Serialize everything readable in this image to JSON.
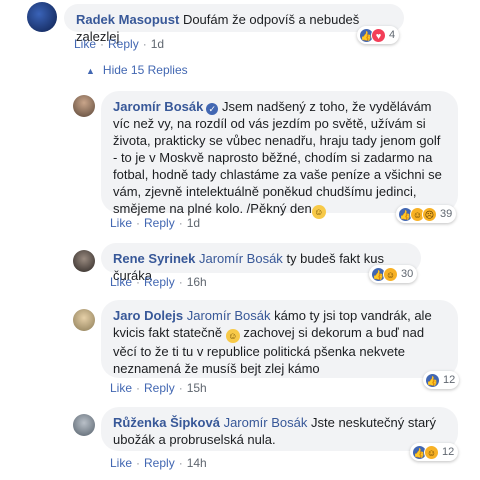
{
  "colors": {
    "link": "#385898",
    "bubble": "#f2f3f5",
    "action": "#4267b2"
  },
  "hide_replies": "Hide 15 Replies",
  "comments": [
    {
      "author": "Radek Masopust",
      "text": "Doufám že odpovíš a nebudeš zalezlej",
      "like": "Like",
      "reply": "Reply",
      "time": "1d",
      "reactions": "4",
      "reaction_icons": [
        "like-icon",
        "love-icon"
      ]
    },
    {
      "author": "Jaromír Bosák",
      "text": "Jsem nadšený z toho, že vydělávám víc než vy, na rozdíl od vás jezdím po světě, užívám si života, prakticky se vůbec nenadřu, hraju tady jenom golf - to je v Moskvě naprosto běžné, chodím si zadarmo na fotbal, hodně tady chlastáme za vaše peníze a všichni se vám, zjevně intelektuálně poněkud chudšímu jedinci, smějeme na plné kolo. /Pěkný den",
      "like": "Like",
      "reply": "Reply",
      "time": "1d",
      "reactions": "39",
      "reaction_icons": [
        "like-icon",
        "haha-icon",
        "sad-icon"
      ]
    },
    {
      "author": "Rene Syrinek",
      "mention": "Jaromír Bosák",
      "text": "ty budeš fakt kus čuráka",
      "like": "Like",
      "reply": "Reply",
      "time": "16h",
      "reactions": "30",
      "reaction_icons": [
        "like-icon",
        "haha-icon"
      ]
    },
    {
      "author": "Jaro Dolejs",
      "mention": "Jaromír Bosák",
      "text_a": "kámo ty jsi top vandrák, ale kvicis fakt statečně",
      "text_b": "zachovej si dekorum a buď nad věcí to že ti tu v republice politická pšenka nekvete neznamená že musíš bejt zlej kámo",
      "like": "Like",
      "reply": "Reply",
      "time": "15h",
      "reactions": "12",
      "reaction_icons": [
        "like-icon"
      ]
    },
    {
      "author": "Růženka Šipková",
      "mention": "Jaromír Bosák",
      "text": "Jste neskutečný starý ubožák a probruselská nula.",
      "like": "Like",
      "reply": "Reply",
      "time": "14h",
      "reactions": "12",
      "reaction_icons": [
        "like-icon",
        "haha-icon"
      ]
    }
  ]
}
